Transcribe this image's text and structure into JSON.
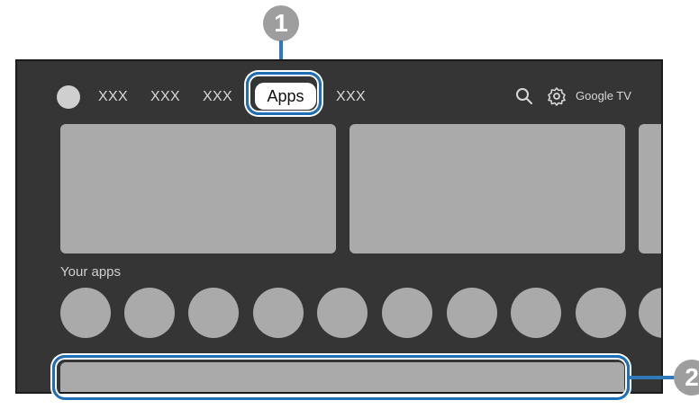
{
  "header": {
    "nav_items": [
      "XXX",
      "XXX",
      "XXX",
      "Apps",
      "XXX"
    ],
    "brand": "Google TV"
  },
  "icons": {
    "search": "search-icon",
    "settings": "settings-icon"
  },
  "sections": {
    "your_apps_label": "Your apps"
  },
  "callouts": {
    "one": "1",
    "two": "2"
  },
  "colors": {
    "screen_bg": "#353535",
    "placeholder": "#aaaaaa",
    "highlight": "#1f6fb6",
    "badge": "#9e9e9e"
  }
}
